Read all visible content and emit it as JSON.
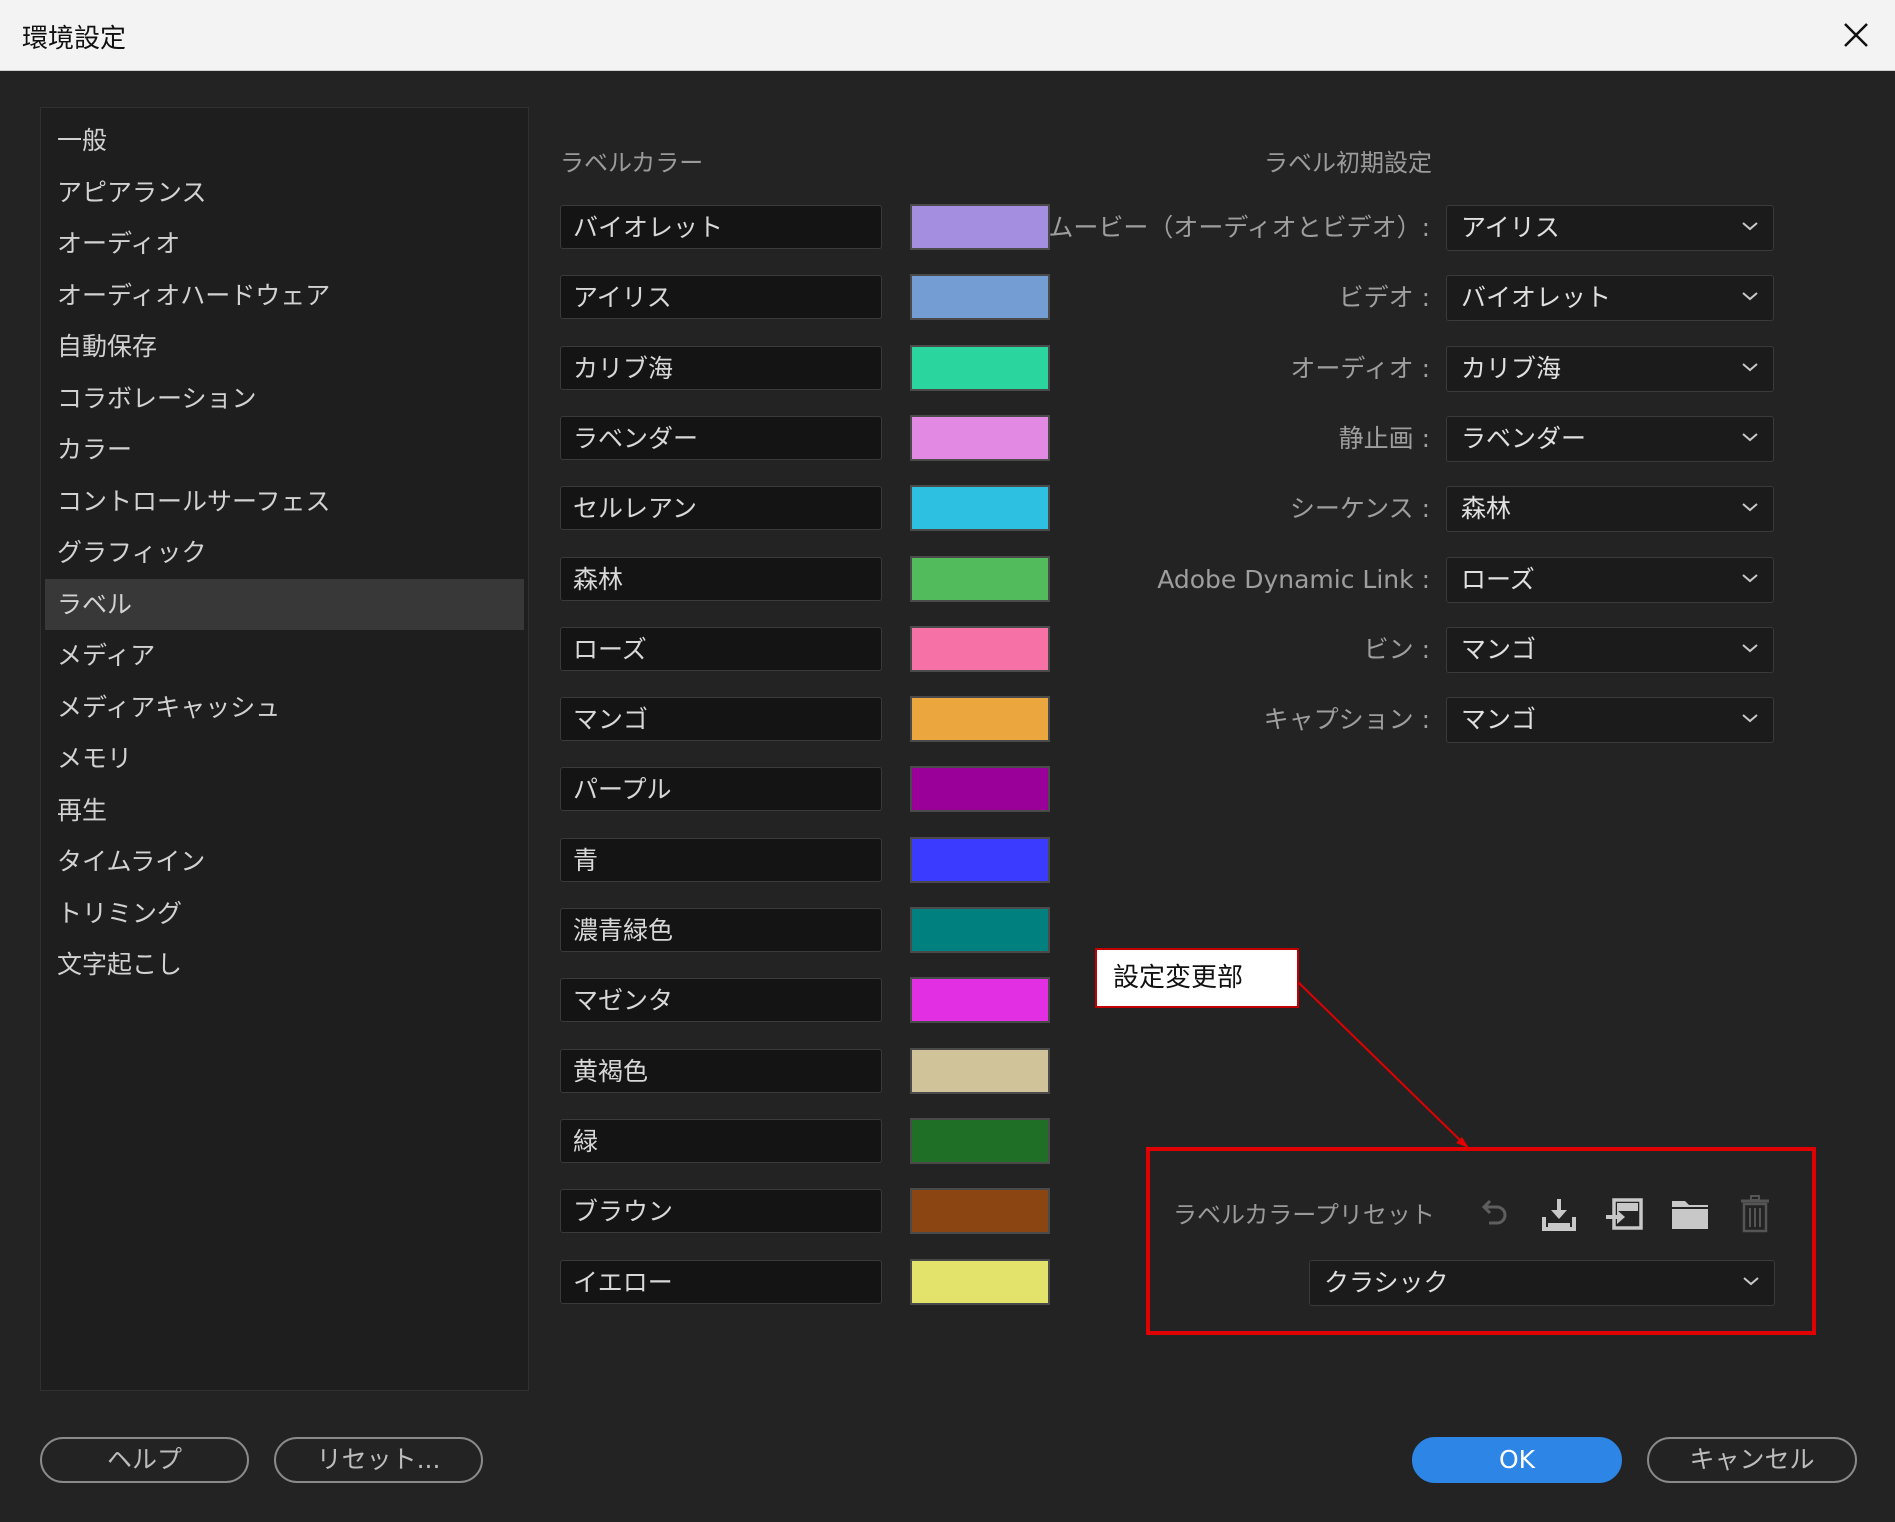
{
  "window": {
    "title": "環境設定"
  },
  "sidebar": {
    "items": [
      {
        "label": "一般"
      },
      {
        "label": "アピアランス"
      },
      {
        "label": "オーディオ"
      },
      {
        "label": "オーディオハードウェア"
      },
      {
        "label": "自動保存"
      },
      {
        "label": "コラボレーション"
      },
      {
        "label": "カラー"
      },
      {
        "label": "コントロールサーフェス"
      },
      {
        "label": "グラフィック"
      },
      {
        "label": "ラベル"
      },
      {
        "label": "メディア"
      },
      {
        "label": "メディアキャッシュ"
      },
      {
        "label": "メモリ"
      },
      {
        "label": "再生"
      },
      {
        "label": "タイムライン"
      },
      {
        "label": "トリミング"
      },
      {
        "label": "文字起こし"
      }
    ],
    "active_index": 9
  },
  "label_colors": {
    "heading": "ラベルカラー",
    "items": [
      {
        "name": "バイオレット",
        "color": "#a38ee0"
      },
      {
        "name": "アイリス",
        "color": "#739dd3"
      },
      {
        "name": "カリブ海",
        "color": "#2ad69e"
      },
      {
        "name": "ラベンダー",
        "color": "#e289e3"
      },
      {
        "name": "セルレアン",
        "color": "#2ec0e1"
      },
      {
        "name": "森林",
        "color": "#52bc5c"
      },
      {
        "name": "ローズ",
        "color": "#f571a6"
      },
      {
        "name": "マンゴ",
        "color": "#eba73e"
      },
      {
        "name": "パープル",
        "color": "#9a0099"
      },
      {
        "name": "青",
        "color": "#3b3bff"
      },
      {
        "name": "濃青緑色",
        "color": "#00807f"
      },
      {
        "name": "マゼンタ",
        "color": "#e32fe3"
      },
      {
        "name": "黄褐色",
        "color": "#d0c399"
      },
      {
        "name": "緑",
        "color": "#1f6f26"
      },
      {
        "name": "ブラウン",
        "color": "#8b4512"
      },
      {
        "name": "イエロー",
        "color": "#e3e26b"
      }
    ]
  },
  "label_defaults": {
    "heading": "ラベル初期設定",
    "rows": [
      {
        "label": "ムービー（オーディオとビデオ）:",
        "value": "アイリス"
      },
      {
        "label": "ビデオ :",
        "value": "バイオレット"
      },
      {
        "label": "オーディオ :",
        "value": "カリブ海"
      },
      {
        "label": "静止画 :",
        "value": "ラベンダー"
      },
      {
        "label": "シーケンス :",
        "value": "森林"
      },
      {
        "label": "Adobe Dynamic Link :",
        "value": "ローズ"
      },
      {
        "label": "ビン :",
        "value": "マンゴ"
      },
      {
        "label": "キャプション :",
        "value": "マンゴ"
      }
    ]
  },
  "annotation": {
    "text": "設定変更部",
    "color": "#e00000"
  },
  "preset": {
    "label": "ラベルカラープリセット",
    "value": "クラシック",
    "tools": [
      "undo-icon",
      "download-icon",
      "import-icon",
      "folder-icon",
      "trash-icon"
    ]
  },
  "footer": {
    "help": "ヘルプ",
    "reset": "リセット...",
    "ok": "OK",
    "cancel": "キャンセル",
    "ok_color": "#2d86e6"
  }
}
